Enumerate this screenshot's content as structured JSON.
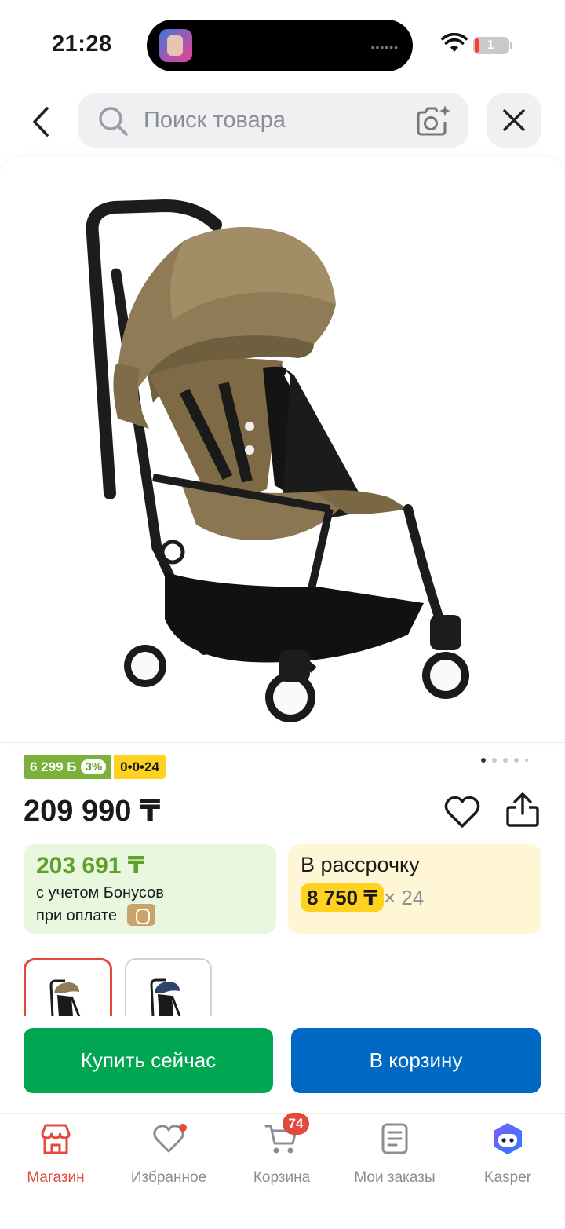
{
  "status_bar": {
    "time": "21:28",
    "battery": "1"
  },
  "search": {
    "placeholder": "Поиск товара"
  },
  "product": {
    "price": "209 990 ₸",
    "bonus_badge": "6 299 Б",
    "bonus_percent": "3%",
    "installment_badge": "0•0•24",
    "gallery": {
      "pages": 5,
      "current": 1
    }
  },
  "bonus_card": {
    "amount": "203 691 ₸",
    "line1": "с учетом Бонусов",
    "line2": "при оплате"
  },
  "installment_card": {
    "title": "В рассрочку",
    "amount": "8 750 ₸",
    "months": "× 24"
  },
  "variants": [
    {
      "name": "taupe",
      "selected": true
    },
    {
      "name": "navy",
      "selected": false
    }
  ],
  "actions": {
    "buy_now": "Купить сейчас",
    "add_to_cart": "В корзину"
  },
  "tabbar": {
    "items": [
      {
        "label": "Магазин",
        "icon": "shop-icon",
        "active": true
      },
      {
        "label": "Избранное",
        "icon": "heart-icon",
        "active": false
      },
      {
        "label": "Корзина",
        "icon": "cart-icon",
        "active": false
      },
      {
        "label": "Мои заказы",
        "icon": "orders-icon",
        "active": false
      },
      {
        "label": "Kasper",
        "icon": "kasper-icon",
        "active": false
      }
    ],
    "cart_count": "74"
  },
  "colors": {
    "accent_red": "#e24a3b",
    "buy_green": "#00a651",
    "cart_blue": "#0069c4",
    "bonus_green": "#5fa12a",
    "installment_yellow": "#ffd21f"
  }
}
